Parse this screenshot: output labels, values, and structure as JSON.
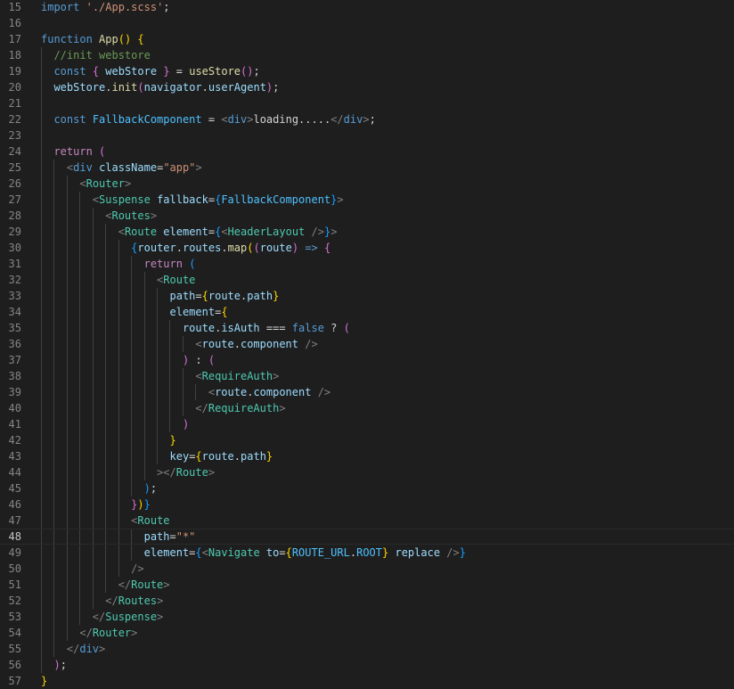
{
  "editor": {
    "active_line": "48",
    "lines": [
      {
        "n": "15",
        "segs": [
          [
            "kw",
            "import"
          ],
          [
            "pl",
            " "
          ],
          [
            "str",
            "'./App.scss'"
          ],
          [
            "pl",
            ";"
          ]
        ]
      },
      {
        "n": "16",
        "segs": []
      },
      {
        "n": "17",
        "segs": [
          [
            "kw",
            "function"
          ],
          [
            "pl",
            " "
          ],
          [
            "fn",
            "App"
          ],
          [
            "b1",
            "()"
          ],
          [
            "pl",
            " "
          ],
          [
            "b1",
            "{"
          ]
        ]
      },
      {
        "n": "18",
        "segs": [
          [
            "pl",
            "  "
          ],
          [
            "cm",
            "//init webstore"
          ]
        ]
      },
      {
        "n": "19",
        "segs": [
          [
            "pl",
            "  "
          ],
          [
            "kw",
            "const"
          ],
          [
            "pl",
            " "
          ],
          [
            "b2",
            "{"
          ],
          [
            "pl",
            " "
          ],
          [
            "var",
            "webStore"
          ],
          [
            "pl",
            " "
          ],
          [
            "b2",
            "}"
          ],
          [
            "pl",
            " = "
          ],
          [
            "fn",
            "useStore"
          ],
          [
            "b2",
            "()"
          ],
          [
            "pl",
            ";"
          ]
        ]
      },
      {
        "n": "20",
        "segs": [
          [
            "pl",
            "  "
          ],
          [
            "var",
            "webStore"
          ],
          [
            "pl",
            "."
          ],
          [
            "fn",
            "init"
          ],
          [
            "b2",
            "("
          ],
          [
            "var",
            "navigator"
          ],
          [
            "pl",
            "."
          ],
          [
            "var",
            "userAgent"
          ],
          [
            "b2",
            ")"
          ],
          [
            "pl",
            ";"
          ]
        ]
      },
      {
        "n": "21",
        "segs": []
      },
      {
        "n": "22",
        "segs": [
          [
            "pl",
            "  "
          ],
          [
            "kw",
            "const"
          ],
          [
            "pl",
            " "
          ],
          [
            "cst",
            "FallbackComponent"
          ],
          [
            "pl",
            " = "
          ],
          [
            "pun",
            "<"
          ],
          [
            "tag",
            "div"
          ],
          [
            "pun",
            ">"
          ],
          [
            "pl",
            "loading....."
          ],
          [
            "pun",
            "</"
          ],
          [
            "tag",
            "div"
          ],
          [
            "pun",
            ">"
          ],
          [
            "pl",
            ";"
          ]
        ]
      },
      {
        "n": "23",
        "segs": []
      },
      {
        "n": "24",
        "segs": [
          [
            "pl",
            "  "
          ],
          [
            "kw2",
            "return"
          ],
          [
            "pl",
            " "
          ],
          [
            "b2",
            "("
          ]
        ]
      },
      {
        "n": "25",
        "segs": [
          [
            "pl",
            "    "
          ],
          [
            "pun",
            "<"
          ],
          [
            "tag",
            "div"
          ],
          [
            "pl",
            " "
          ],
          [
            "var",
            "className"
          ],
          [
            "pl",
            "="
          ],
          [
            "str",
            "\"app\""
          ],
          [
            "pun",
            ">"
          ]
        ]
      },
      {
        "n": "26",
        "segs": [
          [
            "pl",
            "      "
          ],
          [
            "pun",
            "<"
          ],
          [
            "cls",
            "Router"
          ],
          [
            "pun",
            ">"
          ]
        ]
      },
      {
        "n": "27",
        "segs": [
          [
            "pl",
            "        "
          ],
          [
            "pun",
            "<"
          ],
          [
            "cls",
            "Suspense"
          ],
          [
            "pl",
            " "
          ],
          [
            "var",
            "fallback"
          ],
          [
            "pl",
            "="
          ],
          [
            "b3",
            "{"
          ],
          [
            "cst",
            "FallbackComponent"
          ],
          [
            "b3",
            "}"
          ],
          [
            "pun",
            ">"
          ]
        ]
      },
      {
        "n": "28",
        "segs": [
          [
            "pl",
            "          "
          ],
          [
            "pun",
            "<"
          ],
          [
            "cls",
            "Routes"
          ],
          [
            "pun",
            ">"
          ]
        ]
      },
      {
        "n": "29",
        "segs": [
          [
            "pl",
            "            "
          ],
          [
            "pun",
            "<"
          ],
          [
            "cls",
            "Route"
          ],
          [
            "pl",
            " "
          ],
          [
            "var",
            "element"
          ],
          [
            "pl",
            "="
          ],
          [
            "b3",
            "{"
          ],
          [
            "pun",
            "<"
          ],
          [
            "cls",
            "HeaderLayout"
          ],
          [
            "pl",
            " "
          ],
          [
            "pun",
            "/>"
          ],
          [
            "b3",
            "}"
          ],
          [
            "pun",
            ">"
          ]
        ]
      },
      {
        "n": "30",
        "segs": [
          [
            "pl",
            "              "
          ],
          [
            "b3",
            "{"
          ],
          [
            "var",
            "router"
          ],
          [
            "pl",
            "."
          ],
          [
            "var",
            "routes"
          ],
          [
            "pl",
            "."
          ],
          [
            "fn",
            "map"
          ],
          [
            "b1",
            "("
          ],
          [
            "b2",
            "("
          ],
          [
            "var",
            "route"
          ],
          [
            "b2",
            ")"
          ],
          [
            "pl",
            " "
          ],
          [
            "kw",
            "=>"
          ],
          [
            "pl",
            " "
          ],
          [
            "b2",
            "{"
          ]
        ]
      },
      {
        "n": "31",
        "segs": [
          [
            "pl",
            "                "
          ],
          [
            "kw2",
            "return"
          ],
          [
            "pl",
            " "
          ],
          [
            "b3",
            "("
          ]
        ]
      },
      {
        "n": "32",
        "segs": [
          [
            "pl",
            "                  "
          ],
          [
            "pun",
            "<"
          ],
          [
            "cls",
            "Route"
          ]
        ]
      },
      {
        "n": "33",
        "segs": [
          [
            "pl",
            "                    "
          ],
          [
            "var",
            "path"
          ],
          [
            "pl",
            "="
          ],
          [
            "b1",
            "{"
          ],
          [
            "var",
            "route"
          ],
          [
            "pl",
            "."
          ],
          [
            "var",
            "path"
          ],
          [
            "b1",
            "}"
          ]
        ]
      },
      {
        "n": "34",
        "segs": [
          [
            "pl",
            "                    "
          ],
          [
            "var",
            "element"
          ],
          [
            "pl",
            "="
          ],
          [
            "b1",
            "{"
          ]
        ]
      },
      {
        "n": "35",
        "segs": [
          [
            "pl",
            "                      "
          ],
          [
            "var",
            "route"
          ],
          [
            "pl",
            "."
          ],
          [
            "var",
            "isAuth"
          ],
          [
            "pl",
            " === "
          ],
          [
            "kw",
            "false"
          ],
          [
            "pl",
            " ? "
          ],
          [
            "b2",
            "("
          ]
        ]
      },
      {
        "n": "36",
        "segs": [
          [
            "pl",
            "                        "
          ],
          [
            "pun",
            "<"
          ],
          [
            "var",
            "route"
          ],
          [
            "pl",
            "."
          ],
          [
            "var",
            "component"
          ],
          [
            "pl",
            " "
          ],
          [
            "pun",
            "/>"
          ]
        ]
      },
      {
        "n": "37",
        "segs": [
          [
            "pl",
            "                      "
          ],
          [
            "b2",
            ")"
          ],
          [
            "pl",
            " : "
          ],
          [
            "b2",
            "("
          ]
        ]
      },
      {
        "n": "38",
        "segs": [
          [
            "pl",
            "                        "
          ],
          [
            "pun",
            "<"
          ],
          [
            "cls",
            "RequireAuth"
          ],
          [
            "pun",
            ">"
          ]
        ]
      },
      {
        "n": "39",
        "segs": [
          [
            "pl",
            "                          "
          ],
          [
            "pun",
            "<"
          ],
          [
            "var",
            "route"
          ],
          [
            "pl",
            "."
          ],
          [
            "var",
            "component"
          ],
          [
            "pl",
            " "
          ],
          [
            "pun",
            "/>"
          ]
        ]
      },
      {
        "n": "40",
        "segs": [
          [
            "pl",
            "                        "
          ],
          [
            "pun",
            "</"
          ],
          [
            "cls",
            "RequireAuth"
          ],
          [
            "pun",
            ">"
          ]
        ]
      },
      {
        "n": "41",
        "segs": [
          [
            "pl",
            "                      "
          ],
          [
            "b2",
            ")"
          ]
        ]
      },
      {
        "n": "42",
        "segs": [
          [
            "pl",
            "                    "
          ],
          [
            "b1",
            "}"
          ]
        ]
      },
      {
        "n": "43",
        "segs": [
          [
            "pl",
            "                    "
          ],
          [
            "var",
            "key"
          ],
          [
            "pl",
            "="
          ],
          [
            "b1",
            "{"
          ],
          [
            "var",
            "route"
          ],
          [
            "pl",
            "."
          ],
          [
            "var",
            "path"
          ],
          [
            "b1",
            "}"
          ]
        ]
      },
      {
        "n": "44",
        "segs": [
          [
            "pl",
            "                  "
          ],
          [
            "pun",
            "></"
          ],
          [
            "cls",
            "Route"
          ],
          [
            "pun",
            ">"
          ]
        ]
      },
      {
        "n": "45",
        "segs": [
          [
            "pl",
            "                "
          ],
          [
            "b3",
            ")"
          ],
          [
            "pl",
            ";"
          ]
        ]
      },
      {
        "n": "46",
        "segs": [
          [
            "pl",
            "              "
          ],
          [
            "b2",
            "}"
          ],
          [
            "b1",
            ")"
          ],
          [
            "b3",
            "}"
          ]
        ]
      },
      {
        "n": "47",
        "segs": [
          [
            "pl",
            "              "
          ],
          [
            "pun",
            "<"
          ],
          [
            "cls",
            "Route"
          ]
        ]
      },
      {
        "n": "48",
        "segs": [
          [
            "pl",
            "                "
          ],
          [
            "var",
            "path"
          ],
          [
            "pl",
            "="
          ],
          [
            "str",
            "\"*\""
          ]
        ]
      },
      {
        "n": "49",
        "segs": [
          [
            "pl",
            "                "
          ],
          [
            "var",
            "element"
          ],
          [
            "pl",
            "="
          ],
          [
            "b3",
            "{"
          ],
          [
            "pun",
            "<"
          ],
          [
            "cls",
            "Navigate"
          ],
          [
            "pl",
            " "
          ],
          [
            "var",
            "to"
          ],
          [
            "pl",
            "="
          ],
          [
            "b1",
            "{"
          ],
          [
            "cst",
            "ROUTE_URL"
          ],
          [
            "pl",
            "."
          ],
          [
            "cst",
            "ROOT"
          ],
          [
            "b1",
            "}"
          ],
          [
            "pl",
            " "
          ],
          [
            "var",
            "replace"
          ],
          [
            "pl",
            " "
          ],
          [
            "pun",
            "/>"
          ],
          [
            "b3",
            "}"
          ]
        ]
      },
      {
        "n": "50",
        "segs": [
          [
            "pl",
            "              "
          ],
          [
            "pun",
            "/>"
          ]
        ]
      },
      {
        "n": "51",
        "segs": [
          [
            "pl",
            "            "
          ],
          [
            "pun",
            "</"
          ],
          [
            "cls",
            "Route"
          ],
          [
            "pun",
            ">"
          ]
        ]
      },
      {
        "n": "52",
        "segs": [
          [
            "pl",
            "          "
          ],
          [
            "pun",
            "</"
          ],
          [
            "cls",
            "Routes"
          ],
          [
            "pun",
            ">"
          ]
        ]
      },
      {
        "n": "53",
        "segs": [
          [
            "pl",
            "        "
          ],
          [
            "pun",
            "</"
          ],
          [
            "cls",
            "Suspense"
          ],
          [
            "pun",
            ">"
          ]
        ]
      },
      {
        "n": "54",
        "segs": [
          [
            "pl",
            "      "
          ],
          [
            "pun",
            "</"
          ],
          [
            "cls",
            "Router"
          ],
          [
            "pun",
            ">"
          ]
        ]
      },
      {
        "n": "55",
        "segs": [
          [
            "pl",
            "    "
          ],
          [
            "pun",
            "</"
          ],
          [
            "tag",
            "div"
          ],
          [
            "pun",
            ">"
          ]
        ]
      },
      {
        "n": "56",
        "segs": [
          [
            "pl",
            "  "
          ],
          [
            "b2",
            ")"
          ],
          [
            "pl",
            ";"
          ]
        ]
      },
      {
        "n": "57",
        "segs": [
          [
            "b1",
            "}"
          ]
        ]
      }
    ]
  }
}
